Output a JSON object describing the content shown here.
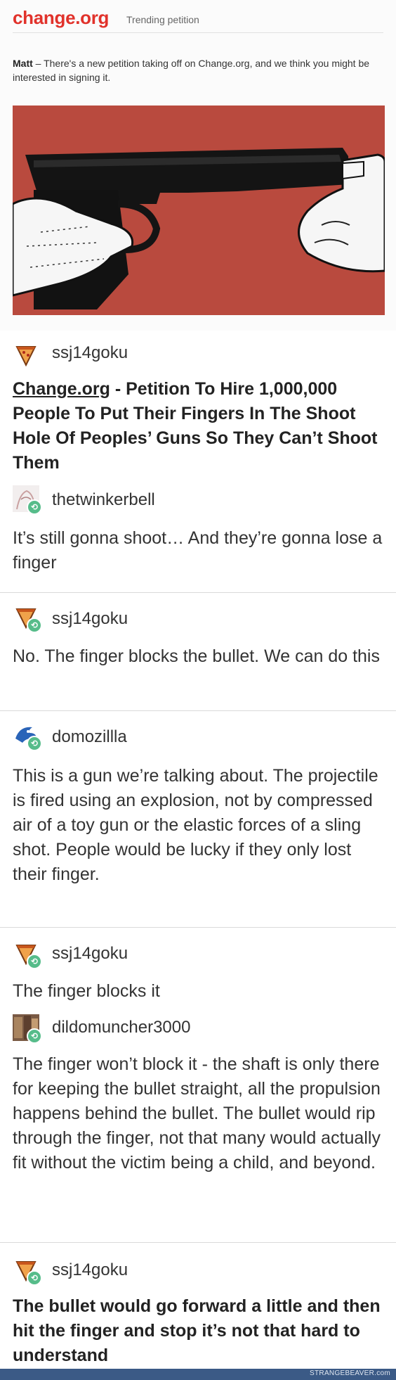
{
  "email": {
    "logo": "change.org",
    "tagline": "Trending petition",
    "greeting_name": "Matt",
    "greeting_text": " – There's a new petition taking off on Change.org, and we think you might be interested in signing it."
  },
  "hero_image": {
    "icon": "gun-finger-illustration",
    "background_color": "#b94a3e"
  },
  "posts": [
    {
      "username": "ssj14goku",
      "avatar_icon": "pizza-slice-avatar",
      "reblog": false,
      "link": "Change.org",
      "text": " - Petition To Hire 1,000,000 People To Put Their Fingers In The Shoot Hole Of Peoples’ Guns So They Can’t Shoot Them"
    },
    {
      "username": "thetwinkerbell",
      "avatar_icon": "sketch-avatar",
      "reblog": true,
      "text": "It’s still gonna shoot… And they’re gonna lose a finger"
    },
    {
      "username": "ssj14goku",
      "avatar_icon": "pizza-slice-avatar",
      "reblog": true,
      "text": "No. The finger blocks the bullet. We can do this"
    },
    {
      "username": "domozillla",
      "avatar_icon": "blue-creature-avatar",
      "reblog": true,
      "text": "This is a gun we’re talking about. The projectile is fired using an explosion, not by compressed air of a toy gun or the elastic forces of a sling shot. People would be lucky if they only lost their finger."
    },
    {
      "username": "ssj14goku",
      "avatar_icon": "pizza-slice-avatar",
      "reblog": true,
      "text": "The finger blocks it"
    },
    {
      "username": "dildomuncher3000",
      "avatar_icon": "photo-avatar",
      "reblog": true,
      "text": "The finger won’t block it - the shaft is only there for keeping the bullet straight, all the propulsion happens behind the bullet. The bullet would rip through the finger, not that many would actually fit without the victim being a child, and beyond."
    },
    {
      "username": "ssj14goku",
      "avatar_icon": "pizza-slice-avatar",
      "reblog": true,
      "text": "The bullet would go forward a little and then hit the finger and stop it’s not that hard to understand"
    }
  ],
  "watermark": "STRANGEBEAVER.com"
}
